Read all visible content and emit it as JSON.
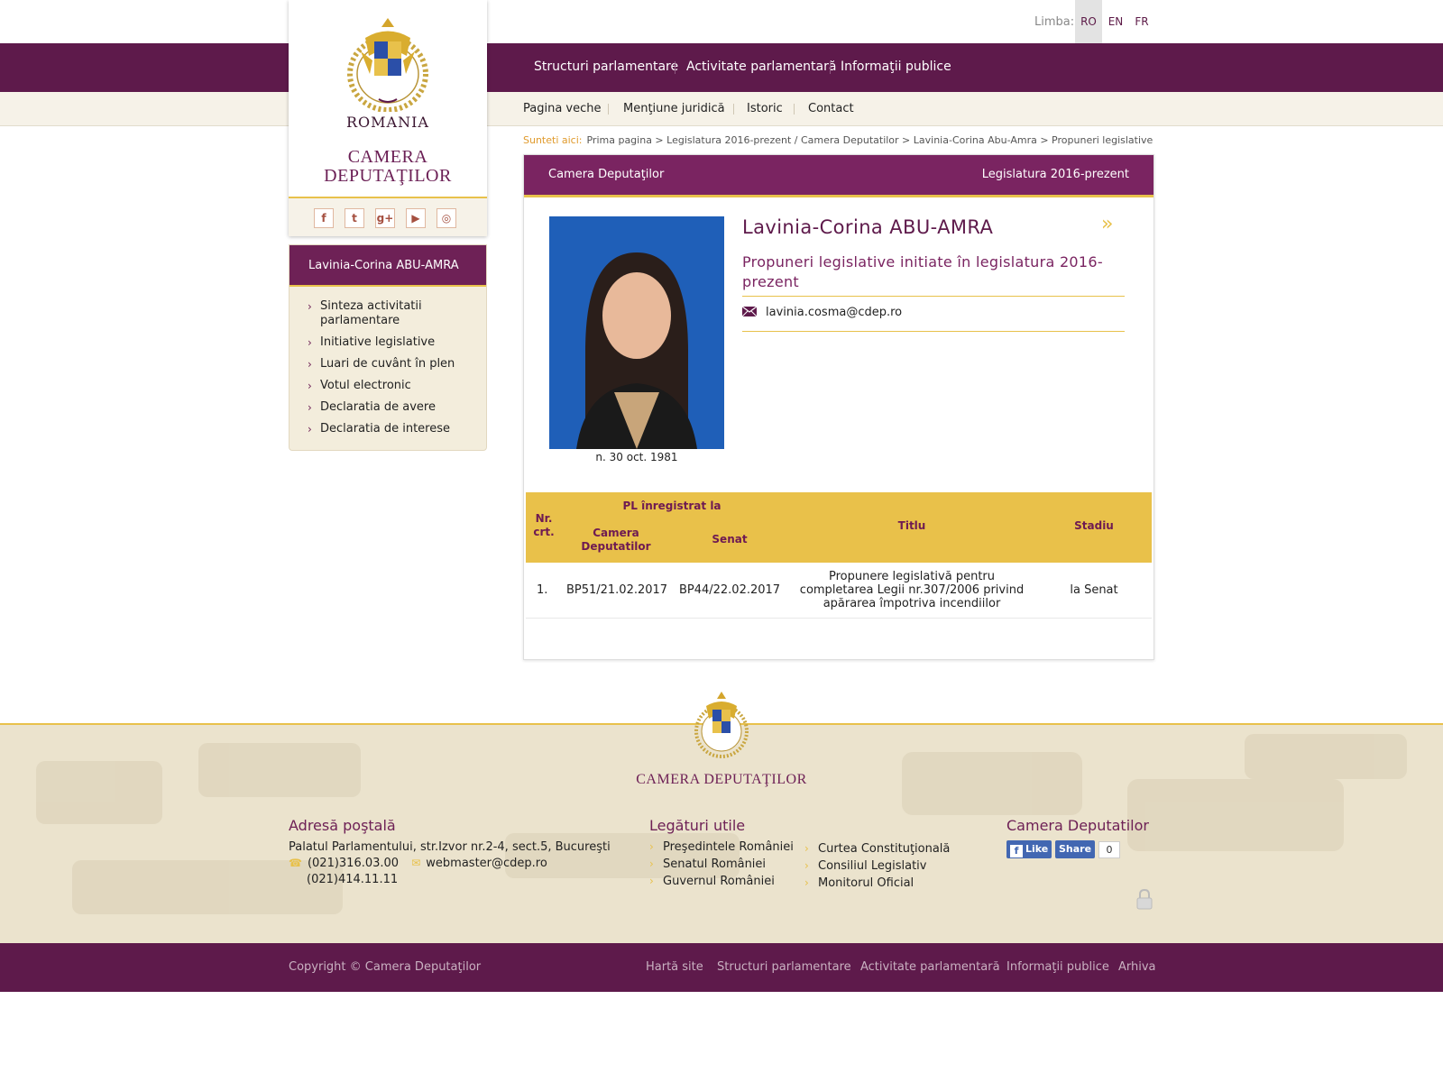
{
  "language": {
    "label": "Limba:",
    "options": [
      "RO",
      "EN",
      "FR"
    ],
    "active": "RO"
  },
  "main_nav": [
    "Structuri parlamentare",
    "Activitate parlamentară",
    "Informaţii publice"
  ],
  "sub_nav": [
    "Pagina veche",
    "Menţiune juridică",
    "Istoric",
    "Contact"
  ],
  "logo": {
    "country": "ROMANIA",
    "line1": "CAMERA",
    "line2": "DEPUTAŢILOR"
  },
  "social_icons": [
    "facebook-icon",
    "twitter-icon",
    "google-plus-icon",
    "youtube-icon",
    "instagram-icon"
  ],
  "profile_menu": {
    "title": "Lavinia-Corina ABU-AMRA",
    "items": [
      "Sinteza activitatii parlamentare",
      "Initiative legislative",
      "Luari de cuvânt în plen",
      "Votul electronic",
      "Declaratia de avere",
      "Declaratia de interese"
    ]
  },
  "breadcrumb": {
    "here_label": "Sunteti aici:",
    "path": "Prima pagina > Legislatura 2016-prezent / Camera Deputatilor > Lavinia-Corina Abu-Amra > Propuneri legislative"
  },
  "panel": {
    "header_left": "Camera Deputaţilor",
    "header_right": "Legislatura 2016-prezent",
    "name": "Lavinia-Corina ABU-AMRA",
    "subtitle": "Propuneri legislative initiate în legislatura 2016-prezent",
    "email": "lavinia.cosma@cdep.ro",
    "birth": "n. 30 oct. 1981",
    "more_glyph": "»"
  },
  "table": {
    "headers": {
      "nr": "Nr. crt.",
      "group": "PL înregistrat la",
      "cdep": "Camera Deputatilor",
      "senat": "Senat",
      "titlu": "Titlu",
      "stadiu": "Stadiu"
    },
    "rows": [
      {
        "nr": "1.",
        "cdep": "BP51/21.02.2017",
        "senat": "BP44/22.02.2017",
        "titlu": "Propunere legislativă pentru completarea Legii nr.307/2006 privind apărarea împotriva incendiilor",
        "stadiu": "la Senat"
      }
    ]
  },
  "footer": {
    "brand": "CAMERA DEPUTAŢILOR",
    "address": {
      "title": "Adresă poştală",
      "line": "Palatul Parlamentului, str.Izvor nr.2-4, sect.5, Bucureşti",
      "phone1": "(021)316.03.00",
      "phone2": "(021)414.11.11",
      "email": "webmaster@cdep.ro"
    },
    "links": {
      "title": "Legături utile",
      "col1": [
        "Preşedintele României",
        "Senatul României",
        "Guvernul României"
      ],
      "col2": [
        "Curtea Constituţională",
        "Consiliul Legislativ",
        "Monitorul Oficial"
      ]
    },
    "social": {
      "title": "Camera Deputatilor",
      "like": "Like",
      "share": "Share",
      "count": "0"
    }
  },
  "bottom_bar": {
    "copyright": "Copyright © Camera Deputaţilor",
    "links": [
      "Hartă site",
      "Structuri parlamentare",
      "Activitate parlamentară",
      "Informaţii publice",
      "Arhiva"
    ]
  },
  "colors": {
    "brand_purple": "#5e1a4b",
    "accent_gold": "#e8c14b",
    "cream": "#f6f2e8"
  }
}
